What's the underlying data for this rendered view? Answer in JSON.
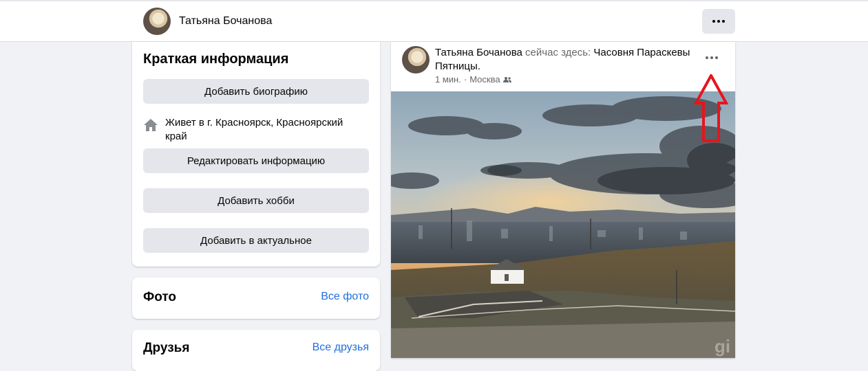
{
  "header": {
    "profile_name": "Татьяна Бочанова",
    "more_label": "..."
  },
  "intro": {
    "title": "Краткая информация",
    "add_bio_label": "Добавить биографию",
    "lives_in": "Живет в г. Красноярск, Красноярский край",
    "edit_info_label": "Редактировать информацию",
    "add_hobby_label": "Добавить хобби",
    "add_featured_label": "Добавить в актуальное"
  },
  "photos": {
    "title": "Фото",
    "all_link": "Все фото"
  },
  "friends": {
    "title": "Друзья",
    "all_link": "Все друзья"
  },
  "post": {
    "author": "Татьяна Бочанова",
    "action": " сейчас здесь: ",
    "place": "Часовня Параскевы Пятницы",
    "place_suffix": ".",
    "time": "1 мин.",
    "separator": " · ",
    "location": "Москва",
    "audience_icon": "friends-icon",
    "image_watermark": "gi"
  },
  "colors": {
    "page_bg": "#f0f2f5",
    "button_bg": "#e4e6eb",
    "link": "#216fdb",
    "annotation_arrow": "#e8141b"
  }
}
